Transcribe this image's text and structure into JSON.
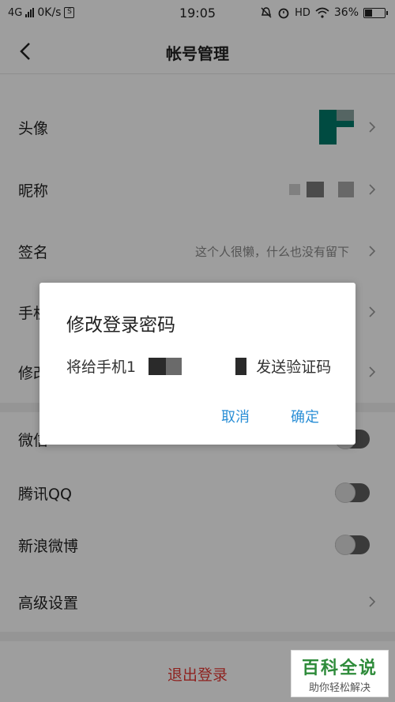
{
  "status_bar": {
    "network": "4G",
    "speed": "0K/s",
    "time": "19:05",
    "hd": "HD",
    "battery": "36%",
    "battery_level": 0.36
  },
  "header": {
    "title": "帐号管理"
  },
  "rows": {
    "avatar": "头像",
    "nickname": "昵称",
    "signature": "签名",
    "signature_value": "这个人很懒，什么也没有留下",
    "phone": "手机",
    "change_password": "修改",
    "wechat": "微信",
    "qq": "腾讯QQ",
    "weibo": "新浪微博",
    "advanced": "高级设置"
  },
  "logout": {
    "label": "退出登录"
  },
  "dialog": {
    "title": "修改登录密码",
    "message_prefix": "将给手机1",
    "message_suffix": "发送验证码",
    "cancel": "取消",
    "confirm": "确定"
  },
  "watermark": {
    "main": "百科全说",
    "sub": "助你轻松解决"
  },
  "colors": {
    "accent": "#2b8fd6",
    "logout": "#e53935",
    "avatar": "#007a6a"
  }
}
